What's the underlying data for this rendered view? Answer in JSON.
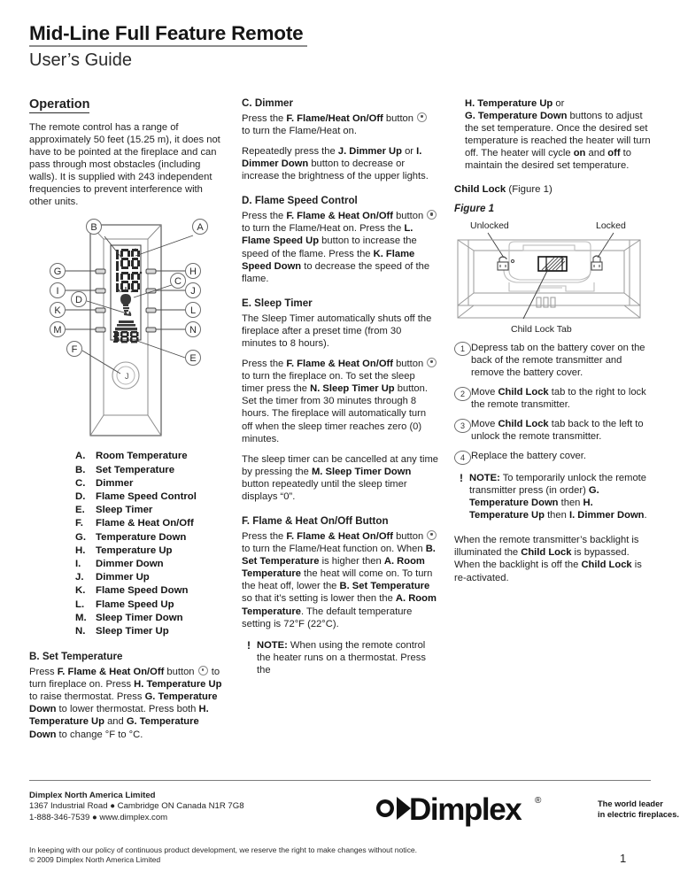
{
  "header": {
    "title": "Mid-Line Full Feature Remote",
    "subtitle": "User’s Guide"
  },
  "column1": {
    "operation_heading": "Operation",
    "intro": "The remote control has a range of approximately 50 feet (15.25 m), it does not have to be pointed at the fireplace and can pass through most obstacles (including walls).  It is supplied with 243 independent frequencies to prevent interference with other units.",
    "diagram": {
      "name": "remote-control-diagram",
      "callouts": [
        "A",
        "B",
        "C",
        "D",
        "E",
        "F",
        "G",
        "H",
        "I",
        "J",
        "K",
        "L",
        "M",
        "N"
      ],
      "button_glyph": "J"
    },
    "legend": [
      {
        "key": "A.",
        "label": "Room Temperature"
      },
      {
        "key": "B.",
        "label": "Set Temperature"
      },
      {
        "key": "C.",
        "label": "Dimmer"
      },
      {
        "key": "D.",
        "label": "Flame Speed Control"
      },
      {
        "key": "E.",
        "label": "Sleep Timer"
      },
      {
        "key": "F.",
        "label": "Flame & Heat On/Off"
      },
      {
        "key": "G.",
        "label": "Temperature Down"
      },
      {
        "key": "H.",
        "label": "Temperature Up"
      },
      {
        "key": "I.",
        "label": "Dimmer Down"
      },
      {
        "key": "J.",
        "label": "Dimmer Up"
      },
      {
        "key": "K.",
        "label": "Flame Speed Down"
      },
      {
        "key": "L.",
        "label": "Flame Speed Up"
      },
      {
        "key": "M.",
        "label": "Sleep Timer Down"
      },
      {
        "key": "N.",
        "label": "Sleep Timer Up"
      }
    ],
    "set_temperature": {
      "heading": "B.  Set Temperature",
      "p1_a": "Press ",
      "p1_b": "F. Flame & Heat On/Off",
      "p1_c": " button ",
      "p1_d": " to turn fireplace on. Press ",
      "p1_e": "H. Temperature Up",
      "p1_f": " to raise thermostat. Press ",
      "p1_g": "G. Temperature Down",
      "p1_h": " to lower thermostat. Press both ",
      "p1_i": "H. Temperature Up",
      "p1_j": " and ",
      "p1_k": "G. Temperature Down",
      "p1_l": " to change °F to °C."
    }
  },
  "column2": {
    "dimmer": {
      "heading": "C.  Dimmer",
      "p1_a": "Press the ",
      "p1_b": "F. Flame/Heat On/Off",
      "p1_c": " button ",
      "p1_d": " to turn the Flame/Heat on.",
      "p2_a": "Repeatedly press the ",
      "p2_b": "J. Dimmer Up",
      "p2_c": " or ",
      "p2_d": "I. Dimmer Down",
      "p2_e": " button to decrease or increase the brightness of the upper lights."
    },
    "flame_speed": {
      "heading": "D.  Flame Speed Control",
      "p1_a": "Press the ",
      "p1_b": "F. Flame & Heat On/Off",
      "p1_c": " button ",
      "p1_d": " to turn the Flame/Heat on. Press the ",
      "p1_e": "L. Flame Speed Up",
      "p1_f": " button to increase the speed of the flame.  Press the ",
      "p1_g": "K. Flame Speed Down",
      "p1_h": " to decrease the speed of the flame."
    },
    "sleep_timer": {
      "heading": "E.  Sleep Timer",
      "p1": "The Sleep Timer automatically shuts off the fireplace after a preset time (from 30 minutes to 8 hours).",
      "p2_a": "Press the ",
      "p2_b": "F. Flame & Heat On/Off",
      "p2_c": " button ",
      "p2_d": " to turn the fireplace on. To set the sleep timer press the ",
      "p2_e": "N. Sleep Timer Up",
      "p2_f": " button.  Set the timer from 30 minutes through 8 hours. The fireplace will automatically turn off when the sleep timer reaches zero (0) minutes.",
      "p3_a": "The sleep timer can be cancelled at any time by pressing the ",
      "p3_b": "M. Sleep Timer Down",
      "p3_c": " button repeatedly until the sleep timer displays “0”."
    },
    "flame_heat_button": {
      "heading": "F.   Flame & Heat On/Off Button",
      "p1_a": "Press the ",
      "p1_b": "F. Flame & Heat On/Off",
      "p1_c": " button ",
      "p1_d": " to turn the Flame/Heat function on. When ",
      "p1_e": "B. Set Temperature",
      "p1_f": " is higher then ",
      "p1_g": "A.  Room Temperature",
      "p1_h": " the heat will come on. To turn the heat off, lower the ",
      "p1_i": "B. Set Temperature",
      "p1_j": " so that it’s setting is lower then the ",
      "p1_k": "A. Room Temperature",
      "p1_l": ". The default temperature setting is 72°F (22°C).",
      "note_bang": "!",
      "note_label": "NOTE:",
      "note_text": "  When using the remote control the heater runs on a thermostat. Press the"
    }
  },
  "column3": {
    "continuation": {
      "a": "H. Temperature Up",
      "b": "  or",
      "c": "G.  Temperature Down",
      "d": " buttons to adjust the set temperature. Once the desired set temperature is reached the heater will turn off. The heater will cycle ",
      "e": "on",
      "f": " and ",
      "g": "off",
      "h": " to maintain the desired set temperature."
    },
    "child_lock_heading_bold": "Child Lock",
    "child_lock_heading_rest": " (Figure 1)",
    "figure_label": "Figure 1",
    "figure": {
      "name": "child-lock-figure",
      "unlocked_label": "Unlocked",
      "locked_label": "Locked",
      "tab_label": "Child Lock Tab"
    },
    "steps": [
      {
        "num": "1",
        "text_a": "Depress tab on the battery cover on the back of the remote transmitter and remove the battery cover.",
        "bold": "",
        "text_b": ""
      },
      {
        "num": "2",
        "text_a": "Move ",
        "bold": "Child Lock",
        "text_b": " tab to the right to lock the remote transmitter."
      },
      {
        "num": "3",
        "text_a": "Move ",
        "bold": "Child Lock",
        "text_b": " tab back to the left to unlock the remote transmitter."
      },
      {
        "num": "4",
        "text_a": "Replace the battery cover.",
        "bold": "",
        "text_b": ""
      }
    ],
    "note": {
      "bang": "!",
      "label": "NOTE:",
      "a": "  To temporarily unlock the remote transmitter press (in order) ",
      "b": "G. Temperature Down",
      "c": " then ",
      "d": "H. Temperature Up",
      "e": " then ",
      "f": "I. Dimmer Down",
      "g": "."
    },
    "backlight": {
      "a": "When the remote transmitter’s backlight is illuminated the ",
      "b": "Child Lock",
      "c": " is bypassed. When the backlight is off the ",
      "d": "Child Lock",
      "e": " is re-activated."
    }
  },
  "footer": {
    "company": "Dimplex North America Limited",
    "address": "1367 Industrial Road ● Cambridge ON Canada N1R 7G8",
    "contact": "1-888-346-7539 ● www.dimplex.com",
    "logo_text": "Dimplex",
    "logo_reg": "®",
    "tagline_line1": "The world leader",
    "tagline_line2": "in electric fireplaces.",
    "disclaimer": "In keeping with our policy of continuous product development, we reserve the right to make changes without notice.",
    "copyright": "© 2009 Dimplex North America Limited",
    "page_number": "1"
  }
}
